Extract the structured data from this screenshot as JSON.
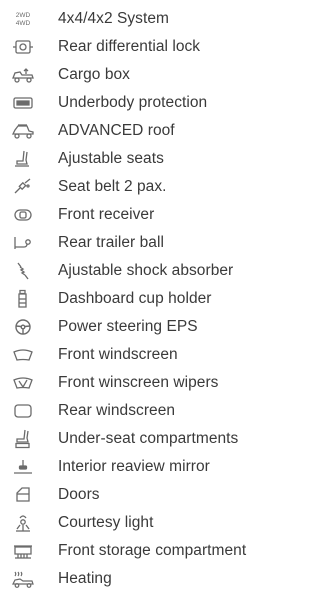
{
  "features": [
    {
      "label": "4x4/4x2 System",
      "icon": "2wd-4wd-icon"
    },
    {
      "label": "Rear differential lock",
      "icon": "differential-lock-icon"
    },
    {
      "label": "Cargo box",
      "icon": "cargo-box-icon"
    },
    {
      "label": "Underbody protection",
      "icon": "underbody-protection-icon"
    },
    {
      "label": "ADVANCED roof",
      "icon": "roof-icon"
    },
    {
      "label": "Ajustable seats",
      "icon": "seat-icon"
    },
    {
      "label": "Seat belt 2 pax.",
      "icon": "seat-belt-icon"
    },
    {
      "label": "Front receiver",
      "icon": "front-receiver-icon"
    },
    {
      "label": "Rear trailer ball",
      "icon": "trailer-ball-icon"
    },
    {
      "label": "Ajustable shock absorber",
      "icon": "shock-absorber-icon"
    },
    {
      "label": "Dashboard cup holder",
      "icon": "cup-holder-icon"
    },
    {
      "label": "Power steering EPS",
      "icon": "steering-wheel-icon"
    },
    {
      "label": "Front windscreen",
      "icon": "front-windscreen-icon"
    },
    {
      "label": "Front winscreen wipers",
      "icon": "wiper-icon"
    },
    {
      "label": "Rear windscreen",
      "icon": "rear-windscreen-icon"
    },
    {
      "label": "Under-seat compartments",
      "icon": "under-seat-compartment-icon"
    },
    {
      "label": "Interior reaview mirror",
      "icon": "rearview-mirror-icon"
    },
    {
      "label": "Doors",
      "icon": "door-icon"
    },
    {
      "label": "Courtesy light",
      "icon": "courtesy-light-icon"
    },
    {
      "label": "Front storage compartment",
      "icon": "storage-compartment-icon"
    },
    {
      "label": "Heating",
      "icon": "heating-icon"
    }
  ],
  "colors": {
    "text": "#3a3a3a",
    "icon": "#6b6b6b",
    "background": "#ffffff"
  }
}
